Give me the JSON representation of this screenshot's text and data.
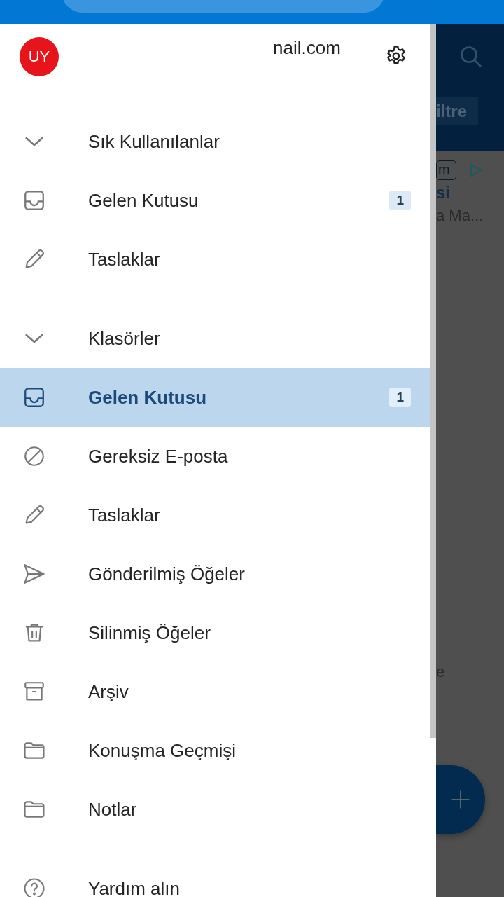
{
  "account": {
    "avatar_initials": "UY",
    "email": "nail.com"
  },
  "sections": [
    {
      "items": [
        {
          "kind": "header",
          "label": "Sık Kullanılanlar",
          "expanded": true
        },
        {
          "kind": "inbox",
          "label": "Gelen Kutusu",
          "count": "1",
          "selected": false
        },
        {
          "kind": "drafts",
          "label": "Taslaklar",
          "selected": false
        }
      ]
    },
    {
      "items": [
        {
          "kind": "header",
          "label": "Klasörler",
          "expanded": true
        },
        {
          "kind": "inbox",
          "label": "Gelen Kutusu",
          "count": "1",
          "selected": true
        },
        {
          "kind": "junk",
          "label": "Gereksiz E-posta",
          "selected": false
        },
        {
          "kind": "drafts",
          "label": "Taslaklar",
          "selected": false
        },
        {
          "kind": "sent",
          "label": "Gönderilmiş Öğeler",
          "selected": false
        },
        {
          "kind": "deleted",
          "label": "Silinmiş Öğeler",
          "selected": false
        },
        {
          "kind": "archive",
          "label": "Arşiv",
          "selected": false
        },
        {
          "kind": "folder",
          "label": "Konuşma Geçmişi",
          "selected": false
        },
        {
          "kind": "folder",
          "label": "Notlar",
          "selected": false
        }
      ]
    },
    {
      "items": [
        {
          "kind": "help",
          "label": "Yardım alın",
          "selected": false
        }
      ]
    }
  ],
  "background_app": {
    "filter_button": "iltre",
    "tag": "m",
    "sender": "si",
    "preview": "a Ma...",
    "line_2": "e"
  }
}
